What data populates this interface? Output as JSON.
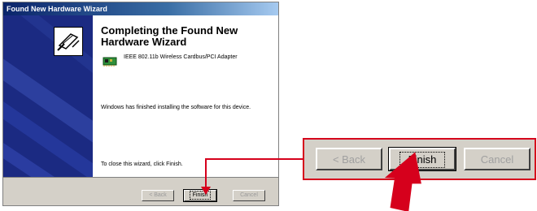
{
  "window": {
    "title": "Found New Hardware Wizard"
  },
  "wizard": {
    "heading": "Completing the Found New Hardware Wizard",
    "device_name": "IEEE 802.11b Wireless Cardbus/PCI Adapter",
    "device_icon": "network-card-icon",
    "finished_text": "Windows has finished installing the software for this device.",
    "close_text": "To close this wizard, click Finish."
  },
  "buttons": {
    "back_label": "< Back",
    "finish_label": "Finish",
    "cancel_label": "Cancel"
  },
  "zoom": {
    "back_label": "< Back",
    "finish_label": "Finish",
    "cancel_label": "Cancel"
  },
  "colors": {
    "title_bar": "#0a246a",
    "side_panel": "#1b2a82",
    "callout_red": "#d6001c",
    "button_face": "#d4d0c8"
  }
}
